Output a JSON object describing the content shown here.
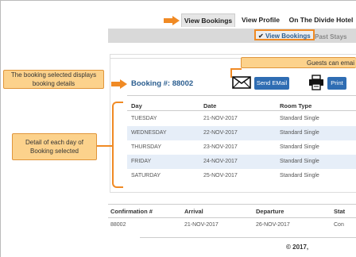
{
  "nav": {
    "tabs": [
      {
        "label": "View Bookings",
        "active": true
      },
      {
        "label": "View Profile",
        "active": false
      },
      {
        "label": "On The Divide Hotel",
        "active": false
      }
    ],
    "subnav": [
      {
        "label": "View Bookings",
        "active": true,
        "check": "✔"
      },
      {
        "label": "Past Stays",
        "active": false
      }
    ]
  },
  "callouts": {
    "guests_email": "Guests can emai",
    "booking_selected": "The booking selected displays booking  details",
    "detail_each_day": "Detail of each day of Booking selected"
  },
  "booking": {
    "title": "Booking #: 88002",
    "send_email_label": "Send EMail",
    "print_label": "Print",
    "columns": [
      "Day",
      "Date",
      "Room Type"
    ],
    "rows": [
      {
        "day": "TUESDAY",
        "date": "21-NOV-2017",
        "room": "Standard Single"
      },
      {
        "day": "WEDNESDAY",
        "date": "22-NOV-2017",
        "room": "Standard Single"
      },
      {
        "day": "THURSDAY",
        "date": "23-NOV-2017",
        "room": "Standard Single"
      },
      {
        "day": "FRIDAY",
        "date": "24-NOV-2017",
        "room": "Standard Single"
      },
      {
        "day": "SATURDAY",
        "date": "25-NOV-2017",
        "room": "Standard Single"
      }
    ]
  },
  "summary": {
    "columns": [
      "Confirmation #",
      "Arrival",
      "Departure",
      "Stat"
    ],
    "row": {
      "confirmation": "88002",
      "arrival": "21-NOV-2017",
      "departure": "26-NOV-2017",
      "status": "Con"
    }
  },
  "footer": {
    "copyright": "© 2017,"
  },
  "colors": {
    "accent": "#f08a24",
    "link": "#2a5d8f",
    "button": "#2f6db3",
    "row_alt": "#e6eef8"
  }
}
